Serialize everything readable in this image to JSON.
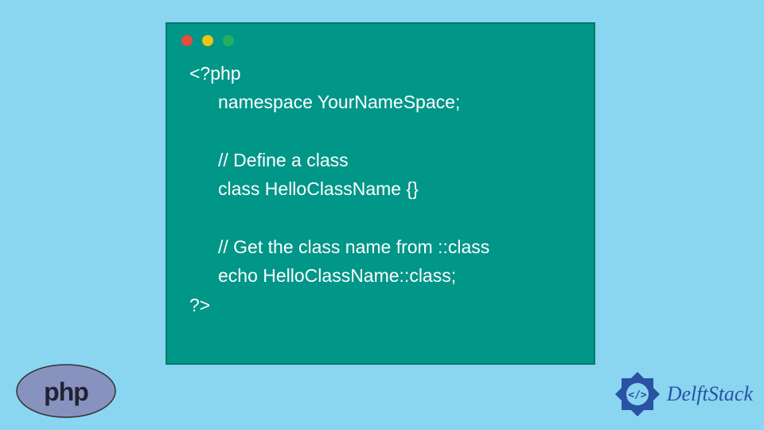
{
  "code": {
    "line1": "<?php",
    "line2": "namespace YourNameSpace;",
    "line3": "// Define a class",
    "line4": "class HelloClassName {}",
    "line5": "// Get the class name from ::class",
    "line6": "echo HelloClassName::class;",
    "line7": "?>"
  },
  "logos": {
    "php": "php",
    "delftstack": "DelftStack"
  },
  "colors": {
    "background": "#8AD5F0",
    "codeWindow": "#009688",
    "phpLogo": "#8892BF",
    "delftstackBlue": "#2952A3"
  }
}
